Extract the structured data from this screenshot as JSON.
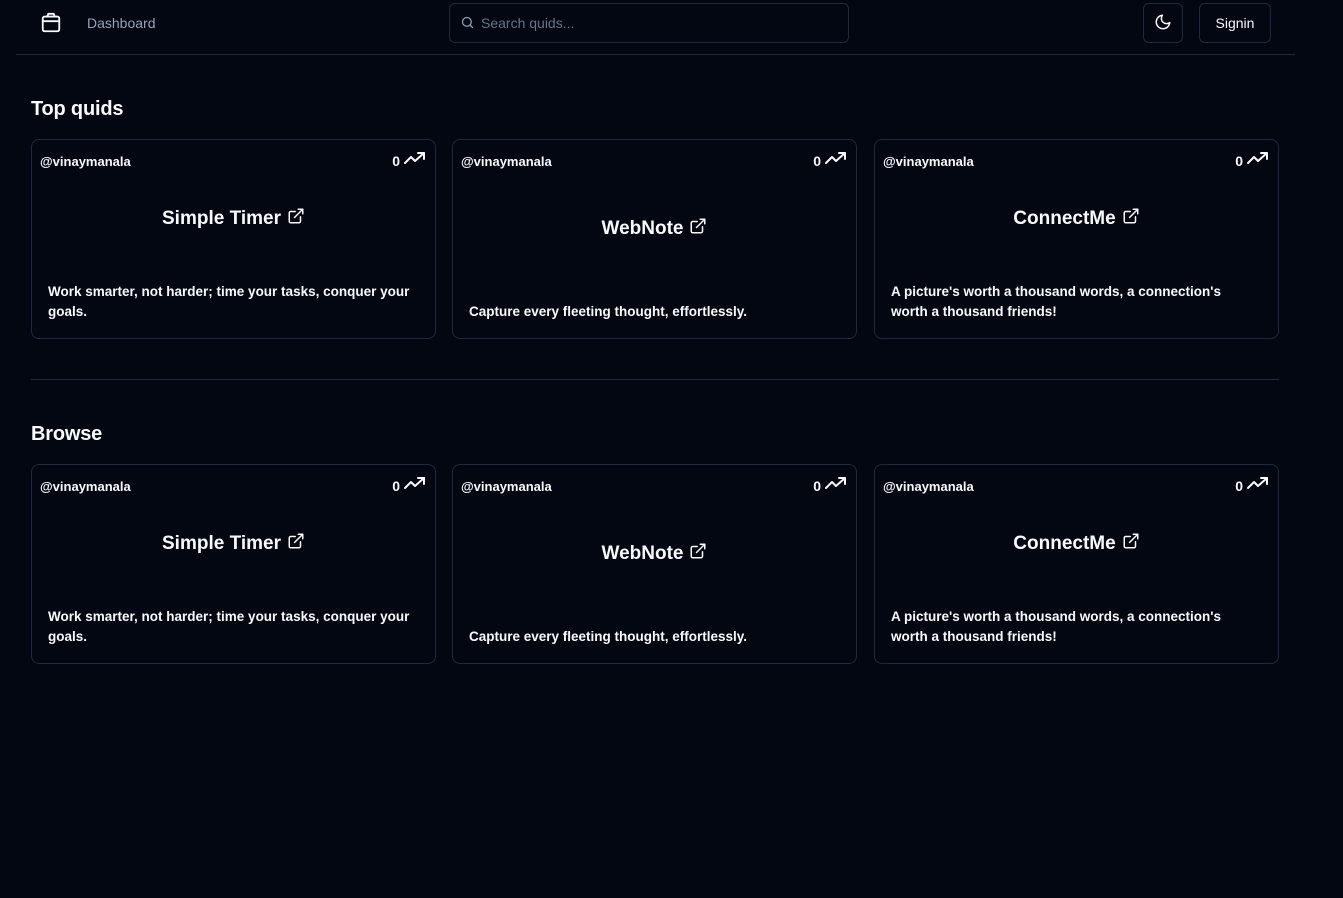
{
  "nav": {
    "link": "Dashboard",
    "search_placeholder": "Search quids...",
    "signin": "Signin"
  },
  "sections": [
    {
      "title": "Top quids",
      "cards": [
        {
          "author": "@vinaymanala",
          "count": "0",
          "title": "Simple Timer",
          "description": "Work smarter, not harder; time your tasks, conquer your goals."
        },
        {
          "author": "@vinaymanala",
          "count": "0",
          "title": "WebNote",
          "description": "Capture every fleeting thought, effortlessly."
        },
        {
          "author": "@vinaymanala",
          "count": "0",
          "title": "ConnectMe",
          "description": "A picture's worth a thousand words, a connection's worth a thousand friends!"
        }
      ]
    },
    {
      "title": "Browse",
      "cards": [
        {
          "author": "@vinaymanala",
          "count": "0",
          "title": "Simple Timer",
          "description": "Work smarter, not harder; time your tasks, conquer your goals."
        },
        {
          "author": "@vinaymanala",
          "count": "0",
          "title": "WebNote",
          "description": "Capture every fleeting thought, effortlessly."
        },
        {
          "author": "@vinaymanala",
          "count": "0",
          "title": "ConnectMe",
          "description": "A picture's worth a thousand words, a connection's worth a thousand friends!"
        }
      ]
    }
  ],
  "icons": {
    "logo": "package-icon",
    "search": "search-icon",
    "theme": "moon-icon",
    "trend": "trending-up-icon",
    "external": "external-link-icon"
  }
}
